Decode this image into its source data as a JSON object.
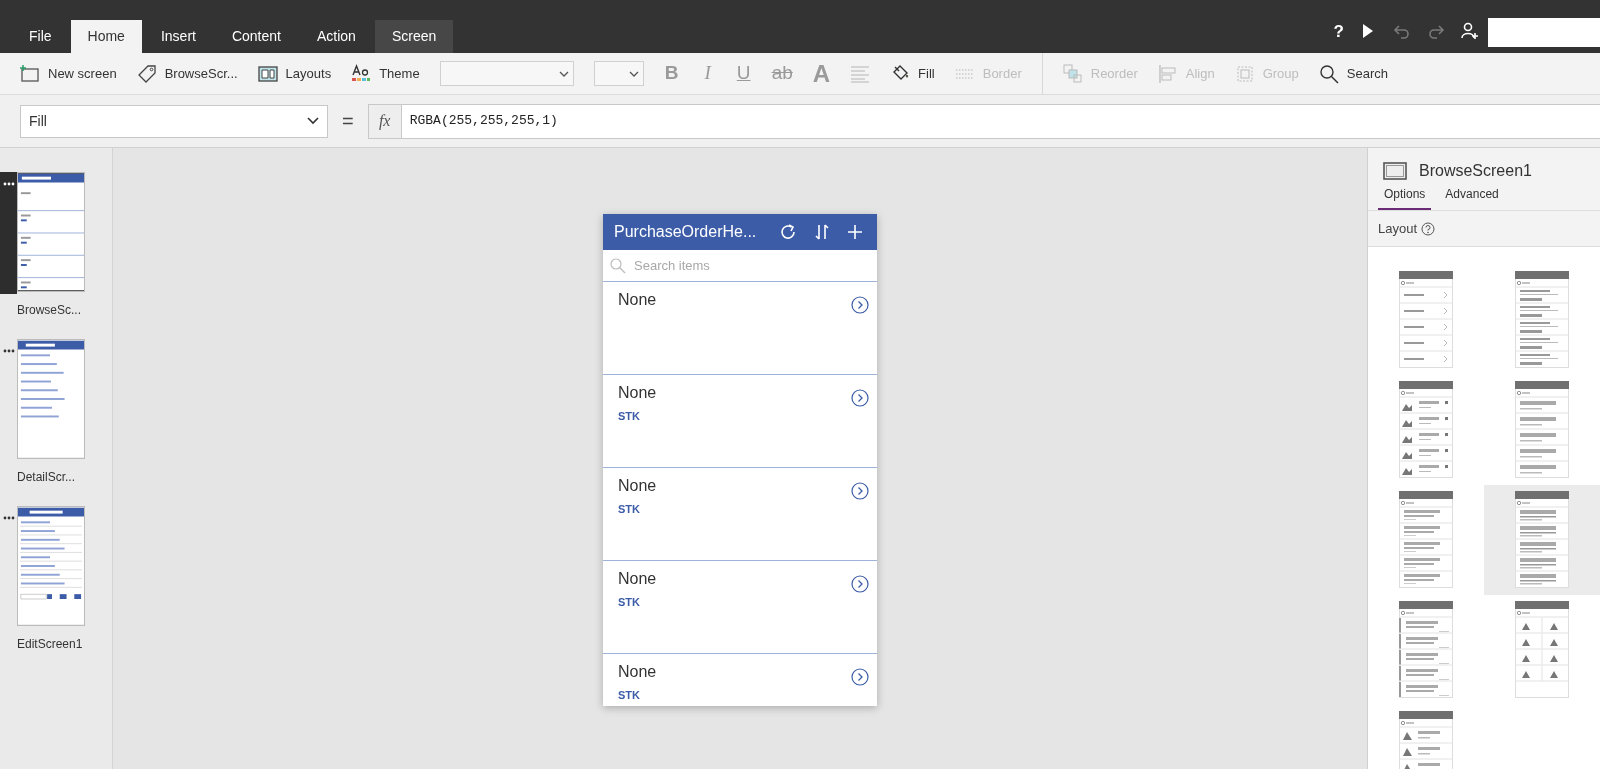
{
  "menu_tabs": [
    {
      "label": "File",
      "selected": false,
      "contextual": false
    },
    {
      "label": "Home",
      "selected": true,
      "contextual": false
    },
    {
      "label": "Insert",
      "selected": false,
      "contextual": false
    },
    {
      "label": "Content",
      "selected": false,
      "contextual": false
    },
    {
      "label": "Action",
      "selected": false,
      "contextual": false
    },
    {
      "label": "Screen",
      "selected": false,
      "contextual": true
    }
  ],
  "title_bar_buttons": [
    {
      "label": "?",
      "disabled": false
    },
    {
      "kind": "play",
      "disabled": false
    },
    {
      "kind": "undo",
      "disabled": true
    },
    {
      "kind": "redo",
      "disabled": true
    },
    {
      "kind": "share",
      "disabled": false
    }
  ],
  "ribbon": [
    {
      "kind": "button",
      "label": "New screen",
      "disabled": false
    },
    {
      "kind": "button",
      "label": "BrowseScr...",
      "disabled": false
    },
    {
      "kind": "button",
      "label": "Layouts",
      "disabled": false
    },
    {
      "kind": "button",
      "label": "Theme",
      "disabled": false
    },
    {
      "kind": "select"
    },
    {
      "kind": "select"
    },
    {
      "kind": "glyph",
      "label": "B",
      "disabled": true
    },
    {
      "kind": "glyph",
      "label": "I",
      "disabled": true
    },
    {
      "kind": "glyph",
      "label": "U",
      "disabled": true
    },
    {
      "kind": "glyph",
      "label": "ab",
      "disabled": true
    },
    {
      "kind": "glyph",
      "label": "A",
      "disabled": true
    },
    {
      "kind": "icon",
      "disabled": true
    },
    {
      "kind": "button",
      "label": "Fill",
      "disabled": false
    },
    {
      "kind": "button",
      "label": "Border",
      "disabled": true
    },
    {
      "kind": "separator"
    },
    {
      "kind": "button",
      "label": "Reorder",
      "disabled": true
    },
    {
      "kind": "button",
      "label": "Align",
      "disabled": true
    },
    {
      "kind": "button",
      "label": "Group",
      "disabled": true
    },
    {
      "kind": "button",
      "label": "Search",
      "disabled": false
    }
  ],
  "formula_bar": {
    "property": "Fill",
    "equals": "=",
    "fx": "fx",
    "formula": "RGBA(255,255,255,1)"
  },
  "screens": [
    {
      "label": "BrowseSc...",
      "kind": "browse",
      "selected": true
    },
    {
      "label": "DetailScr...",
      "kind": "detail",
      "selected": false
    },
    {
      "label": "EditScreen1",
      "kind": "edit",
      "selected": false
    }
  ],
  "app_preview": {
    "title": "PurchaseOrderHe...",
    "search_placeholder": "Search items",
    "items": [
      {
        "title": "None"
      },
      {
        "title": "None",
        "subtitle": "STK"
      },
      {
        "title": "None",
        "subtitle": "STK"
      },
      {
        "title": "None",
        "subtitle": "STK"
      },
      {
        "title": "None",
        "subtitle": "STK"
      }
    ]
  },
  "properties_panel": {
    "screen_name": "BrowseScreen1",
    "tabs": [
      {
        "label": "Options",
        "selected": true
      },
      {
        "label": "Advanced",
        "selected": false
      }
    ],
    "section": "Layout",
    "layouts": [
      {
        "kind": "arrows",
        "selected": false
      },
      {
        "kind": "stars",
        "selected": false
      },
      {
        "kind": "images",
        "selected": false
      },
      {
        "kind": "blocks",
        "selected": false
      },
      {
        "kind": "lines",
        "selected": false
      },
      {
        "kind": "details",
        "selected": true
      },
      {
        "kind": "accent",
        "selected": false
      },
      {
        "kind": "gallery",
        "selected": false
      },
      {
        "kind": "cards",
        "selected": false
      }
    ]
  }
}
